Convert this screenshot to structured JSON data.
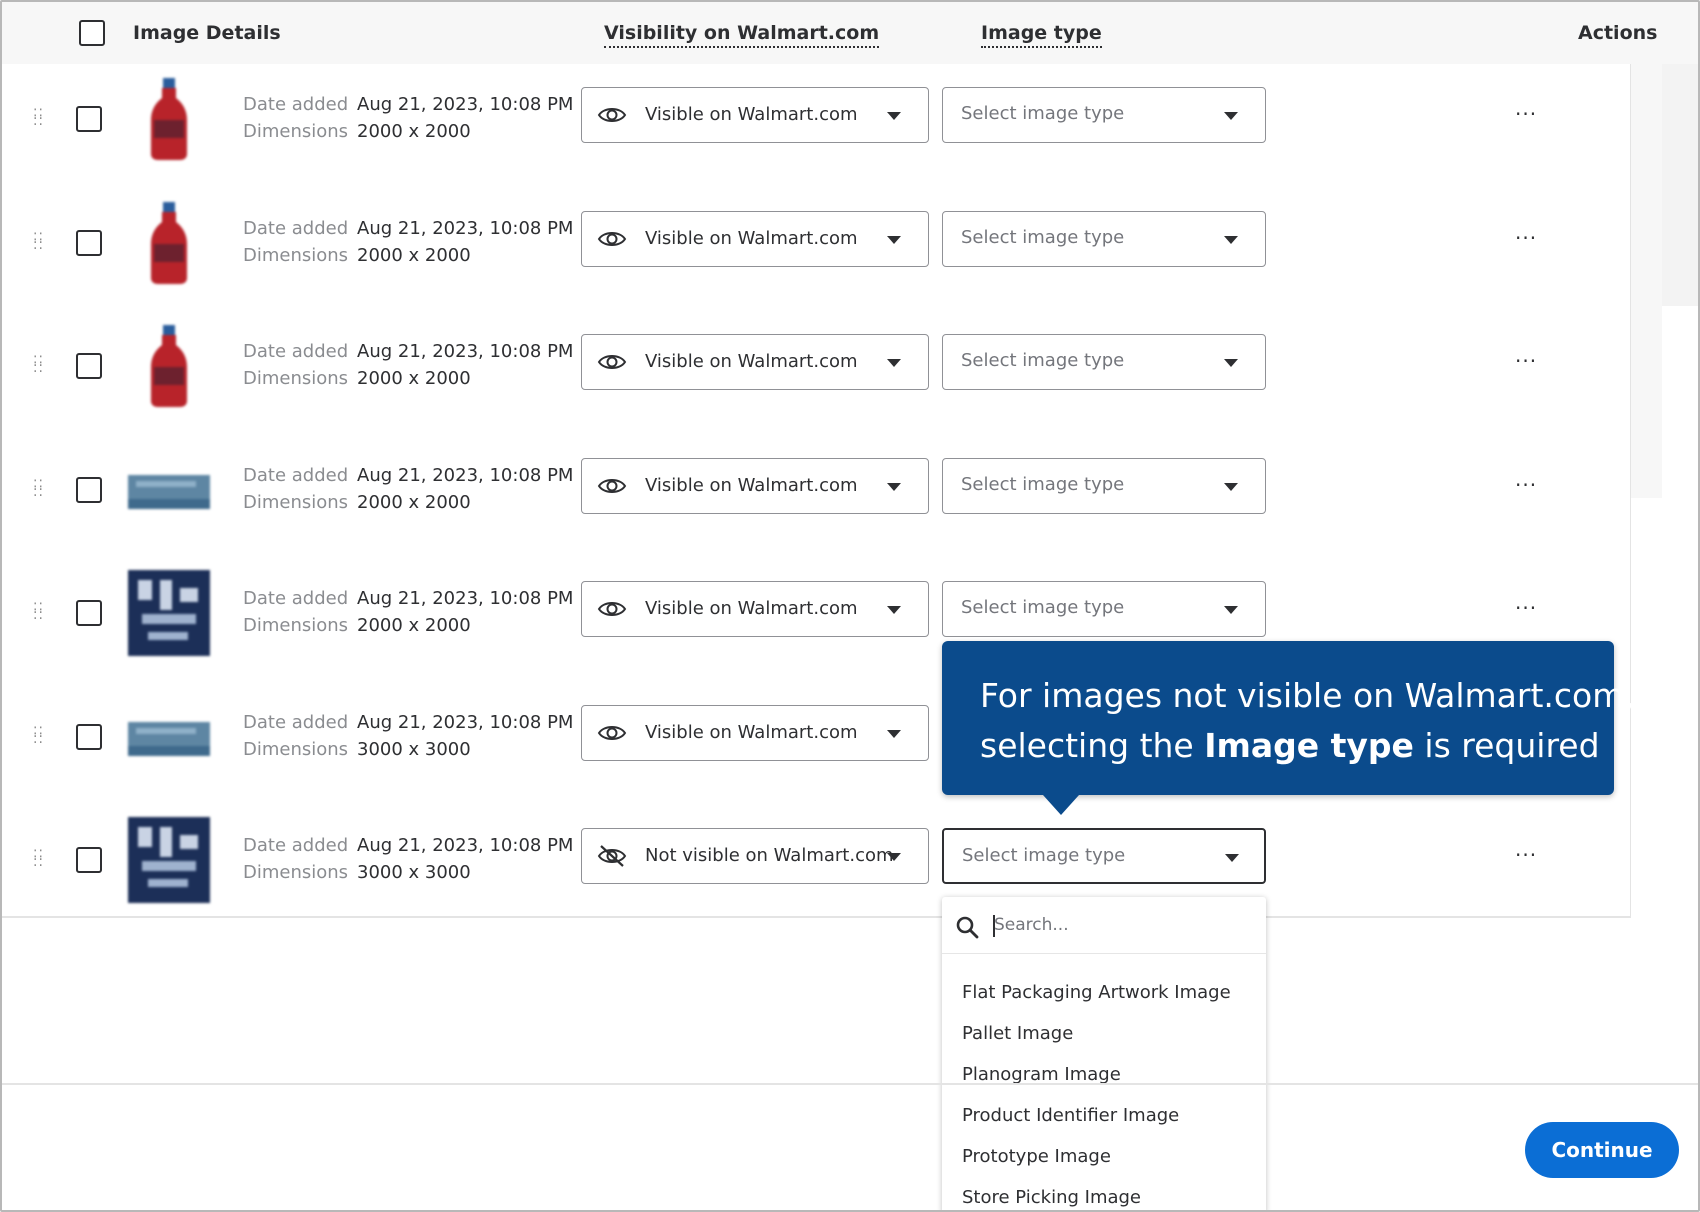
{
  "header": {
    "image_details": "Image Details",
    "visibility": "Visibility on Walmart.com",
    "image_type": "Image type",
    "actions": "Actions"
  },
  "labels": {
    "date_added": "Date added",
    "dimensions": "Dimensions",
    "select_image_type": "Select image type",
    "more_actions": "···"
  },
  "rows": [
    {
      "date": "Aug 21, 2023, 10:08 PM",
      "dimensions": "2000 x 2000",
      "visibility": "Visible on Walmart.com",
      "visible": true,
      "thumb": "bottle"
    },
    {
      "date": "Aug 21, 2023, 10:08 PM",
      "dimensions": "2000 x 2000",
      "visibility": "Visible on Walmart.com",
      "visible": true,
      "thumb": "bottle"
    },
    {
      "date": "Aug 21, 2023, 10:08 PM",
      "dimensions": "2000 x 2000",
      "visibility": "Visible on Walmart.com",
      "visible": true,
      "thumb": "bottle"
    },
    {
      "date": "Aug 21, 2023, 10:08 PM",
      "dimensions": "2000 x 2000",
      "visibility": "Visible on Walmart.com",
      "visible": true,
      "thumb": "strip"
    },
    {
      "date": "Aug 21, 2023, 10:08 PM",
      "dimensions": "2000 x 2000",
      "visibility": "Visible on Walmart.com",
      "visible": true,
      "thumb": "label"
    },
    {
      "date": "Aug 21, 2023, 10:08 PM",
      "dimensions": "3000 x 3000",
      "visibility": "Visible on Walmart.com",
      "visible": true,
      "thumb": "strip"
    },
    {
      "date": "Aug 21, 2023, 10:08 PM",
      "dimensions": "3000 x 3000",
      "visibility": "Not visible on Walmart.com",
      "visible": false,
      "thumb": "label"
    }
  ],
  "tooltip": {
    "line1": "For images not visible on Walmart.com,",
    "line2_pre": "selecting the ",
    "line2_bold": "Image type",
    "line2_post": " is required"
  },
  "dropdown": {
    "search_placeholder": "Search...",
    "options": [
      "Flat Packaging Artwork Image",
      "Pallet Image",
      "Planogram Image",
      "Product Identifier Image",
      "Prototype Image",
      "Store Picking Image"
    ]
  },
  "footer": {
    "continue_label": "Continue"
  },
  "colors": {
    "brand_blue": "#0b6ed5",
    "tooltip_blue": "#0b4b8c",
    "text": "#2e2f32",
    "muted": "#8a8c90"
  },
  "icons": {
    "visible": "eye-icon",
    "not_visible": "eye-off-icon",
    "search": "search-icon",
    "drag": "drag-handle-icon",
    "caret": "caret-down-icon",
    "more": "more-horizontal-icon"
  }
}
